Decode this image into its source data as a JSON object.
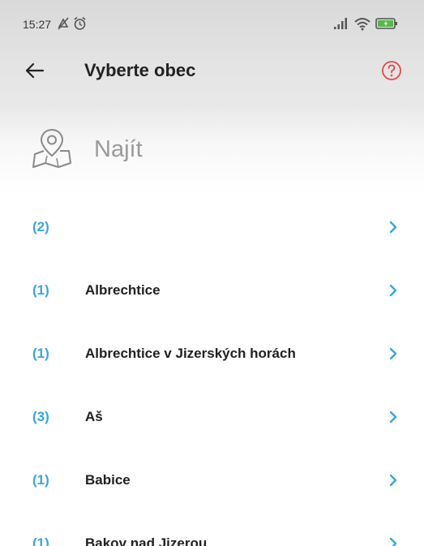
{
  "status_bar": {
    "time": "15:27",
    "icons": [
      "mute-icon",
      "alarm-icon",
      "signal-icon",
      "wifi-icon",
      "battery-charging-icon"
    ]
  },
  "app_bar": {
    "back_icon": "arrow-left-icon",
    "title": "Vyberte obec",
    "help_icon": "question-circle-icon"
  },
  "search": {
    "icon": "map-pin-icon",
    "placeholder": "Najít",
    "value": ""
  },
  "colors": {
    "accent": "#3aa6dd",
    "help_red": "#e04848",
    "header_gray": "#e0e0e0"
  },
  "list": {
    "items": [
      {
        "count": "(2)",
        "name": ""
      },
      {
        "count": "(1)",
        "name": "Albrechtice"
      },
      {
        "count": "(1)",
        "name": "Albrechtice v Jizerských horách"
      },
      {
        "count": "(3)",
        "name": "Aš"
      },
      {
        "count": "(1)",
        "name": "Babice"
      },
      {
        "count": "(1)",
        "name": "Bakov nad Jizerou"
      }
    ]
  }
}
